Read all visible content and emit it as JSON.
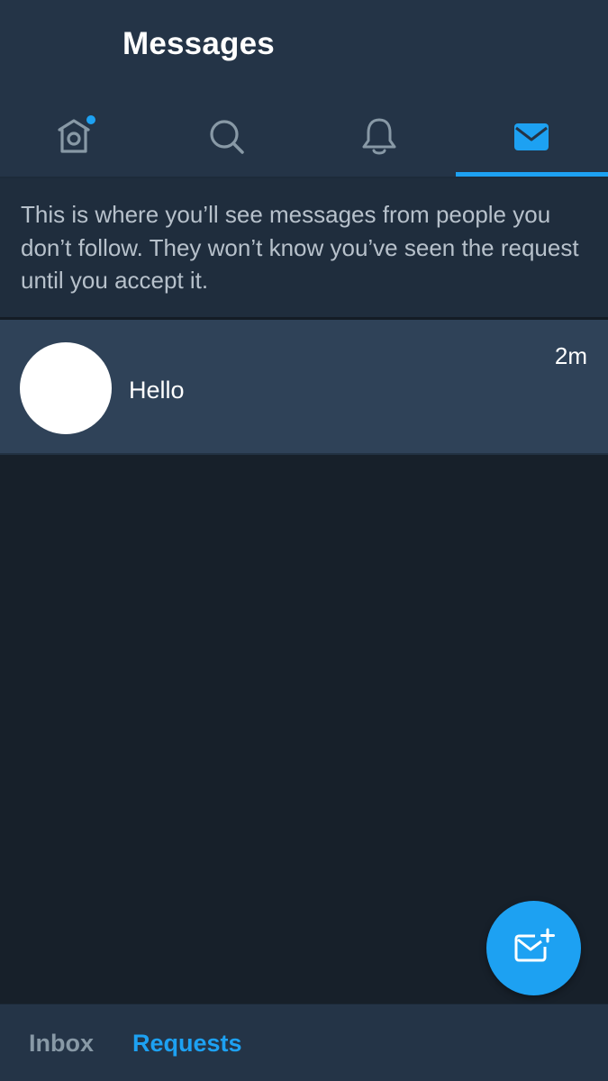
{
  "header": {
    "title": "Messages",
    "tabs": [
      {
        "name": "home",
        "icon": "home-icon",
        "has_dot": true,
        "active": false
      },
      {
        "name": "search",
        "icon": "search-icon",
        "active": false
      },
      {
        "name": "notifications",
        "icon": "bell-icon",
        "active": false
      },
      {
        "name": "messages",
        "icon": "envelope-icon",
        "active": true
      }
    ]
  },
  "info_banner": {
    "text": "This is where you’ll see messages from people you don’t follow. They won’t know you’ve seen the request until you accept it."
  },
  "requests": [
    {
      "preview": "Hello",
      "time": "2m",
      "avatar": "avatar"
    }
  ],
  "fab": {
    "icon": "new-message-icon"
  },
  "bottom_tabs": {
    "inbox": "Inbox",
    "requests": "Requests",
    "active": "requests"
  },
  "colors": {
    "accent": "#1da1f2",
    "header_bg": "#243447",
    "background": "#17202a",
    "row_bg": "#2f4258",
    "inactive_icon": "#8899a6"
  }
}
